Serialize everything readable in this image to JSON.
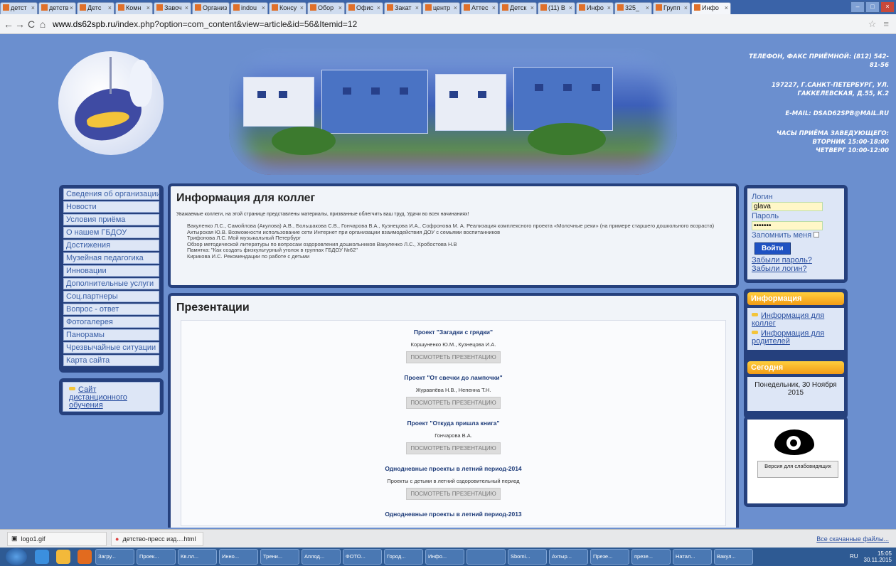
{
  "browser": {
    "tabs": [
      "детст",
      "детств",
      "Детс",
      "Комн",
      "Завоч",
      "Организ",
      "indou",
      "Консу",
      "Обор",
      "Офис",
      "Закат",
      "центр",
      "Аттес",
      "Детск",
      "(11) В",
      "Инфо",
      "325_",
      "Групп",
      "Инфо"
    ],
    "active_tab": "Инфо",
    "url_domain": "www.ds62spb.ru",
    "url_path": "/index.php?option=com_content&view=article&id=56&Itemid=12"
  },
  "header": {
    "contact_phone": "ТЕЛЕФОН, ФАКС ПРИЁМНОЙ: (812) 542-81-56",
    "address": "197227, Г.САНКТ-ПЕТЕРБУРГ, УЛ. ГАККЕЛЕВСКАЯ, Д.55, К.2",
    "email": "E-MAIL: DSAD62SPB@MAIL.RU",
    "hours_title": "ЧАСЫ ПРИЁМА ЗАВЕДУЮЩЕГО:",
    "hours_1": "ВТОРНИК 15:00-18:00",
    "hours_2": "ЧЕТВЕРГ 10:00-12:00"
  },
  "menu": [
    "Сведения об организации",
    "Новости",
    "Условия приёма",
    "О нашем ГБДОУ",
    "Достижения",
    "Музейная педагогика",
    "Инновации",
    "Дополнительные услуги",
    "Соц.партнеры",
    "Вопрос - ответ",
    "Фотогалерея",
    "Панорамы",
    "Чрезвычайные ситуации",
    "Карта сайта"
  ],
  "distance_link": "Сайт дистанционного обучения",
  "article": {
    "title": "Информация для коллег",
    "intro": "Уважаемые коллеги, на этой странице представлены материалы, призванные облегчить ваш труд. Удачи во всех начинаниях!",
    "items": [
      "Вакуленко Л.С., Самойлова (Акулова) А.В., Большакова С.В., Гончарова В.А., Кузнецова И.А., Софронова М. А. Реализация комплексного проекта «Молочные реки» (на примере старшего дошкольного возраста)",
      "Ахтырская Ю.В. Возможности использование сети Интернет при организации взаимодействия ДОУ с семьями воспитанников",
      "Трифонова Л.С. Мой музыкальный Петербург",
      "Обзор методической литературы по вопросам оздоровления дошкольников Вакуленко Л.С., Хробостова Н.В",
      "Памятка: \"Как создать физкультурный уголок в группах ГБДОУ №62\"",
      "Кирикова И.С. Рекомендации по работе с детьми"
    ]
  },
  "presentations": {
    "title": "Презентации",
    "button_label": "ПОСМОТРЕТЬ ПРЕЗЕНТАЦИЮ",
    "list": [
      {
        "title": "Проект \"Загадки с грядки\"",
        "authors": "Коршуненко Ю.М., Кузнецова И.А."
      },
      {
        "title": "Проект \"От свечки до лампочки\"",
        "authors": "Журавлёва Н.В., Непенна Т.Н."
      },
      {
        "title": "Проект \"Откуда пришла книга\"",
        "authors": "Гончарова В.А."
      },
      {
        "title": "Однодневные проекты в летний период-2014",
        "authors": "Проекты с детьми в летний оздоровительный период"
      },
      {
        "title": "Однодневные проекты в летний период-2013",
        "authors": ""
      }
    ]
  },
  "login": {
    "login_label": "Логин",
    "login_value": "glava",
    "password_label": "Пароль",
    "password_value": "•••••••",
    "remember_label": "Запомнить меня",
    "submit_label": "Войти",
    "forgot_password": "Забыли пароль?",
    "forgot_login": "Забыли логин?"
  },
  "info": {
    "header": "Информация",
    "links": [
      "Информация для коллег",
      "Информация для родителей"
    ]
  },
  "today": {
    "header": "Сегодня",
    "date": "Понедельник, 30 Ноября 2015"
  },
  "vision": {
    "button_label": "Версия для слабовидящих"
  },
  "downloads": {
    "items": [
      "logo1.gif",
      "детство-пресс изд....html"
    ],
    "show_all": "Все скачанные файлы..."
  },
  "taskbar": {
    "items": [
      "Загру...",
      "Проек...",
      "Кв.пл...",
      "Инно...",
      "Трени...",
      "Аплод...",
      "ФОТО...",
      "Город...",
      "Инфо...",
      "",
      "Sbomi...",
      "Ахтыр...",
      "Презе...",
      "презе...",
      "Натал...",
      "Вакул..."
    ],
    "lang": "RU",
    "time": "15:05",
    "date": "30.11.2015"
  }
}
